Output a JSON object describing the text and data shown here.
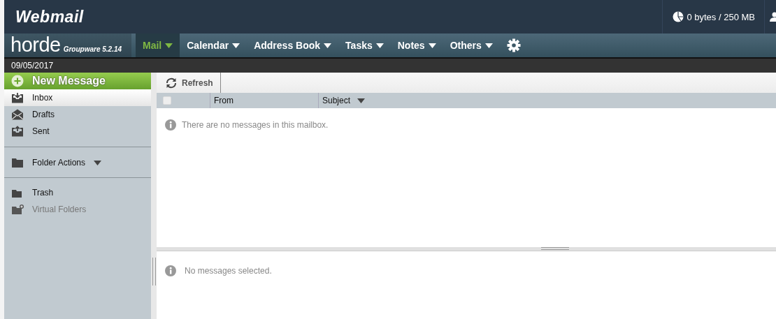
{
  "header": {
    "logo": "Webmail",
    "quota": "0 bytes / 250 MB"
  },
  "nav": {
    "brand": "horde",
    "version": "Groupware 5.2.14",
    "items": [
      {
        "label": "Mail",
        "selected": true
      },
      {
        "label": "Calendar",
        "selected": false
      },
      {
        "label": "Address Book",
        "selected": false
      },
      {
        "label": "Tasks",
        "selected": false
      },
      {
        "label": "Notes",
        "selected": false
      },
      {
        "label": "Others",
        "selected": false
      }
    ]
  },
  "date": "09/05/2017",
  "sidebar": {
    "new_message": "New Message",
    "mailboxes": [
      {
        "label": "Inbox",
        "selected": true
      },
      {
        "label": "Drafts",
        "selected": false
      },
      {
        "label": "Sent",
        "selected": false
      }
    ],
    "folder_actions": "Folder Actions",
    "folders": [
      {
        "label": "Trash",
        "disabled": false
      },
      {
        "label": "Virtual Folders",
        "disabled": true
      }
    ]
  },
  "toolbar": {
    "refresh": "Refresh"
  },
  "table": {
    "select_all": {
      "checked": false
    },
    "columns": [
      "From",
      "Subject"
    ],
    "empty": "There are no messages in this mailbox."
  },
  "preview": {
    "empty": "No messages selected."
  }
}
